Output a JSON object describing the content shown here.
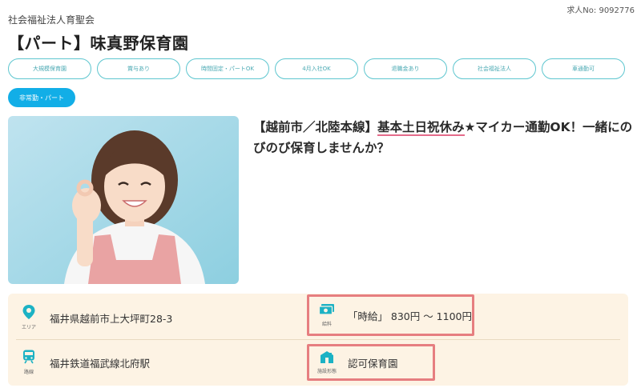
{
  "header": {
    "job_no": "求人No: 9092776",
    "org": "社会福祉法人育聖会",
    "title": "【パート】味真野保育園"
  },
  "tags": [
    "大規模保育園",
    "賞与あり",
    "時間固定・パートOK",
    "4月入社OK",
    "退職金あり",
    "社会福祉法人",
    "車通勤可"
  ],
  "employment_type": "非常勤・パート",
  "headline": {
    "prefix": "【越前市／北陸本線】",
    "highlight": "基本土日祝休み",
    "suffix": "★マイカー通勤OK！一緒にのびのび保育しませんか？"
  },
  "info": {
    "area_label": "エリア",
    "area_value": "福井県越前市上大坪町28-3",
    "salary_label": "給料",
    "salary_value": "「時給」 830円 ～ 1100円",
    "route_label": "路線",
    "route_value": "福井鉄道福武線北府駅",
    "facility_label": "施設形態",
    "facility_value": "認可保育園"
  },
  "colors": {
    "accent_teal": "#5ec6cf",
    "badge_blue": "#12aee7",
    "highlight_pink": "#e56b8a",
    "box_red": "#e67e80",
    "info_bg": "#fdf3e4"
  },
  "icons": [
    "location-pin-icon",
    "money-icon",
    "train-icon",
    "building-icon"
  ]
}
